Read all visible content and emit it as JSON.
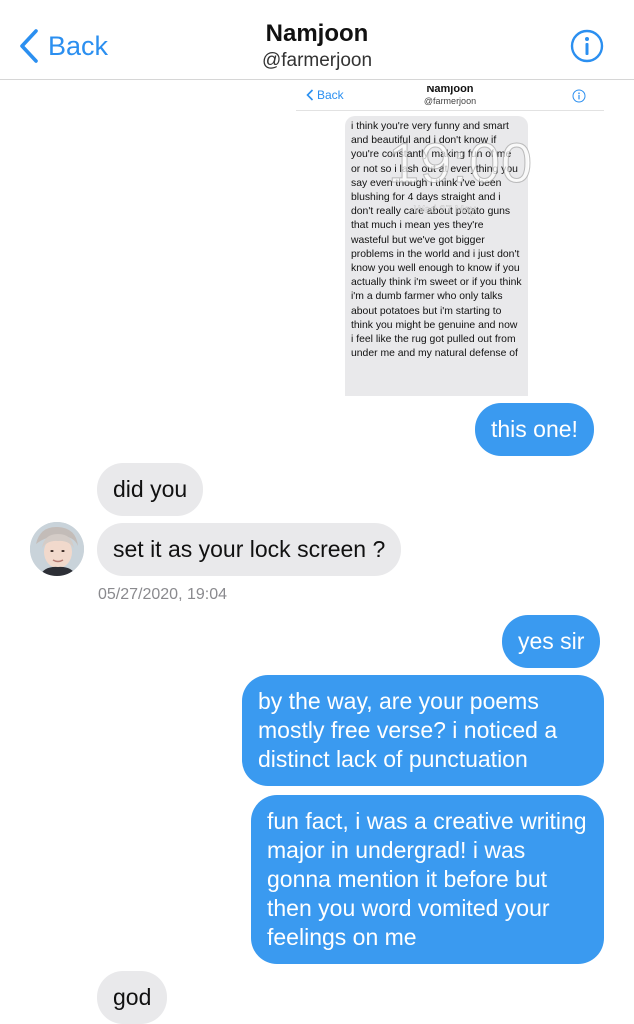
{
  "header": {
    "back_label": "Back",
    "name": "Namjoon",
    "handle": "@farmerjoon"
  },
  "screenshot": {
    "back_label": "Back",
    "name": "Namjoon",
    "handle": "@farmerjoon",
    "lock_time": "19:00",
    "lock_date": "Wed 27 May",
    "message": "i think you're very funny and smart and beautiful and i don't know if you're constantly making fun of me or not so i lash out at everything you say even though i think i've been blushing for 4 days straight and i don't really care about potato guns that much i mean yes they're wasteful but we've got bigger problems in the world and i just don't know you well enough to know if you actually think i'm sweet or if you think i'm a dumb farmer who only talks about potatoes but i'm starting to think you might be genuine and now i feel like the rug got pulled out from under me and my natural defense of"
  },
  "messages": {
    "m1": "this one!",
    "m2": "did you",
    "m3": "set it as your lock screen ?",
    "timestamp": "05/27/2020, 19:04",
    "m4": "yes sir",
    "m5": "by the way, are your poems mostly free verse? i noticed a distinct lack of punctuation",
    "m6": "fun fact, i was a creative writing major in undergrad! i was gonna mention it before but then you word vomited your feelings on me",
    "m7": "god"
  },
  "colors": {
    "accent": "#2b8ff0",
    "outgoing_bubble": "#3a9af0",
    "incoming_bubble": "#e9e9eb"
  }
}
